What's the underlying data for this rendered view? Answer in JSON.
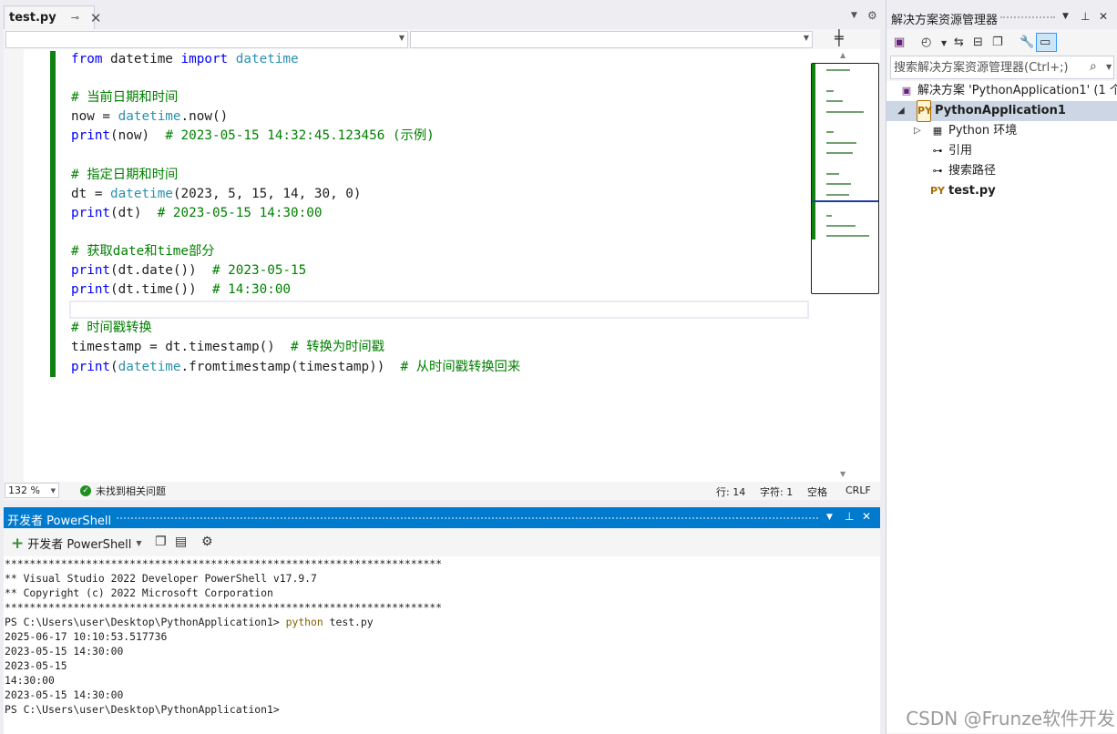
{
  "editor": {
    "tab": {
      "title": "test.py"
    },
    "lines": [
      [
        {
          "t": "from",
          "c": "kw"
        },
        {
          "t": " datetime ",
          "c": "fn"
        },
        {
          "t": "import",
          "c": "kw"
        },
        {
          "t": " ",
          "c": "fn"
        },
        {
          "t": "datetime",
          "c": "ty"
        }
      ],
      [],
      [
        {
          "t": "# 当前日期和时间",
          "c": "cm"
        }
      ],
      [
        {
          "t": "now = ",
          "c": "fn"
        },
        {
          "t": "datetime",
          "c": "ty"
        },
        {
          "t": ".now()",
          "c": "fn"
        }
      ],
      [
        {
          "t": "print",
          "c": "kw"
        },
        {
          "t": "(now)  ",
          "c": "fn"
        },
        {
          "t": "# 2023-05-15 14:32:45.123456 (示例)",
          "c": "cm"
        }
      ],
      [],
      [
        {
          "t": "# 指定日期和时间",
          "c": "cm"
        }
      ],
      [
        {
          "t": "dt = ",
          "c": "fn"
        },
        {
          "t": "datetime",
          "c": "ty"
        },
        {
          "t": "(2023, 5, 15, 14, 30, 0)",
          "c": "fn"
        }
      ],
      [
        {
          "t": "print",
          "c": "kw"
        },
        {
          "t": "(dt)  ",
          "c": "fn"
        },
        {
          "t": "# 2023-05-15 14:30:00",
          "c": "cm"
        }
      ],
      [],
      [
        {
          "t": "# 获取date和time部分",
          "c": "cm"
        }
      ],
      [
        {
          "t": "print",
          "c": "kw"
        },
        {
          "t": "(dt.date())  ",
          "c": "fn"
        },
        {
          "t": "# 2023-05-15",
          "c": "cm"
        }
      ],
      [
        {
          "t": "print",
          "c": "kw"
        },
        {
          "t": "(dt.time())  ",
          "c": "fn"
        },
        {
          "t": "# 14:30:00",
          "c": "cm"
        }
      ],
      [],
      [
        {
          "t": "# 时间戳转换",
          "c": "cm"
        }
      ],
      [
        {
          "t": "timestamp = dt.timestamp()  ",
          "c": "fn"
        },
        {
          "t": "# 转换为时间戳",
          "c": "cm"
        }
      ],
      [
        {
          "t": "print",
          "c": "kw"
        },
        {
          "t": "(",
          "c": "fn"
        },
        {
          "t": "datetime",
          "c": "ty"
        },
        {
          "t": ".fromtimestamp(timestamp))  ",
          "c": "fn"
        },
        {
          "t": "# 从时间戳转换回来",
          "c": "cm"
        }
      ]
    ],
    "status": {
      "zoom": "132 %",
      "issues": "未找到相关问题",
      "line": "行: 14",
      "char": "字符: 1",
      "whitespace": "空格",
      "eol": "CRLF"
    }
  },
  "powershell": {
    "title": "开发者 PowerShell",
    "new_label": "开发者 PowerShell",
    "output": [
      {
        "text": "**********************************************************************"
      },
      {
        "text": "** Visual Studio 2022 Developer PowerShell v17.9.7"
      },
      {
        "text": "** Copyright (c) 2022 Microsoft Corporation"
      },
      {
        "text": "**********************************************************************"
      },
      {
        "text": "PS C:\\Users\\user\\Desktop\\PythonApplication1> ",
        "cmd": "python",
        "args": " test.py"
      },
      {
        "text": "2025-06-17 10:10:53.517736"
      },
      {
        "text": "2023-05-15 14:30:00"
      },
      {
        "text": "2023-05-15"
      },
      {
        "text": "14:30:00"
      },
      {
        "text": "2023-05-15 14:30:00"
      },
      {
        "text": "PS C:\\Users\\user\\Desktop\\PythonApplication1>"
      }
    ]
  },
  "solution_explorer": {
    "title": "解决方案资源管理器",
    "search_placeholder": "搜索解决方案资源管理器(Ctrl+;)",
    "nodes": {
      "solution": "解决方案 'PythonApplication1' (1 个",
      "project": "PythonApplication1",
      "env": "Python 环境",
      "refs": "引用",
      "search_paths": "搜索路径",
      "file": "test.py"
    }
  },
  "watermark": "CSDN @Frunze软件开发",
  "colors": {
    "accent": "#007acc",
    "keyword": "#0000ff",
    "type": "#2b91af",
    "comment": "#008000",
    "changebar": "#108010"
  }
}
